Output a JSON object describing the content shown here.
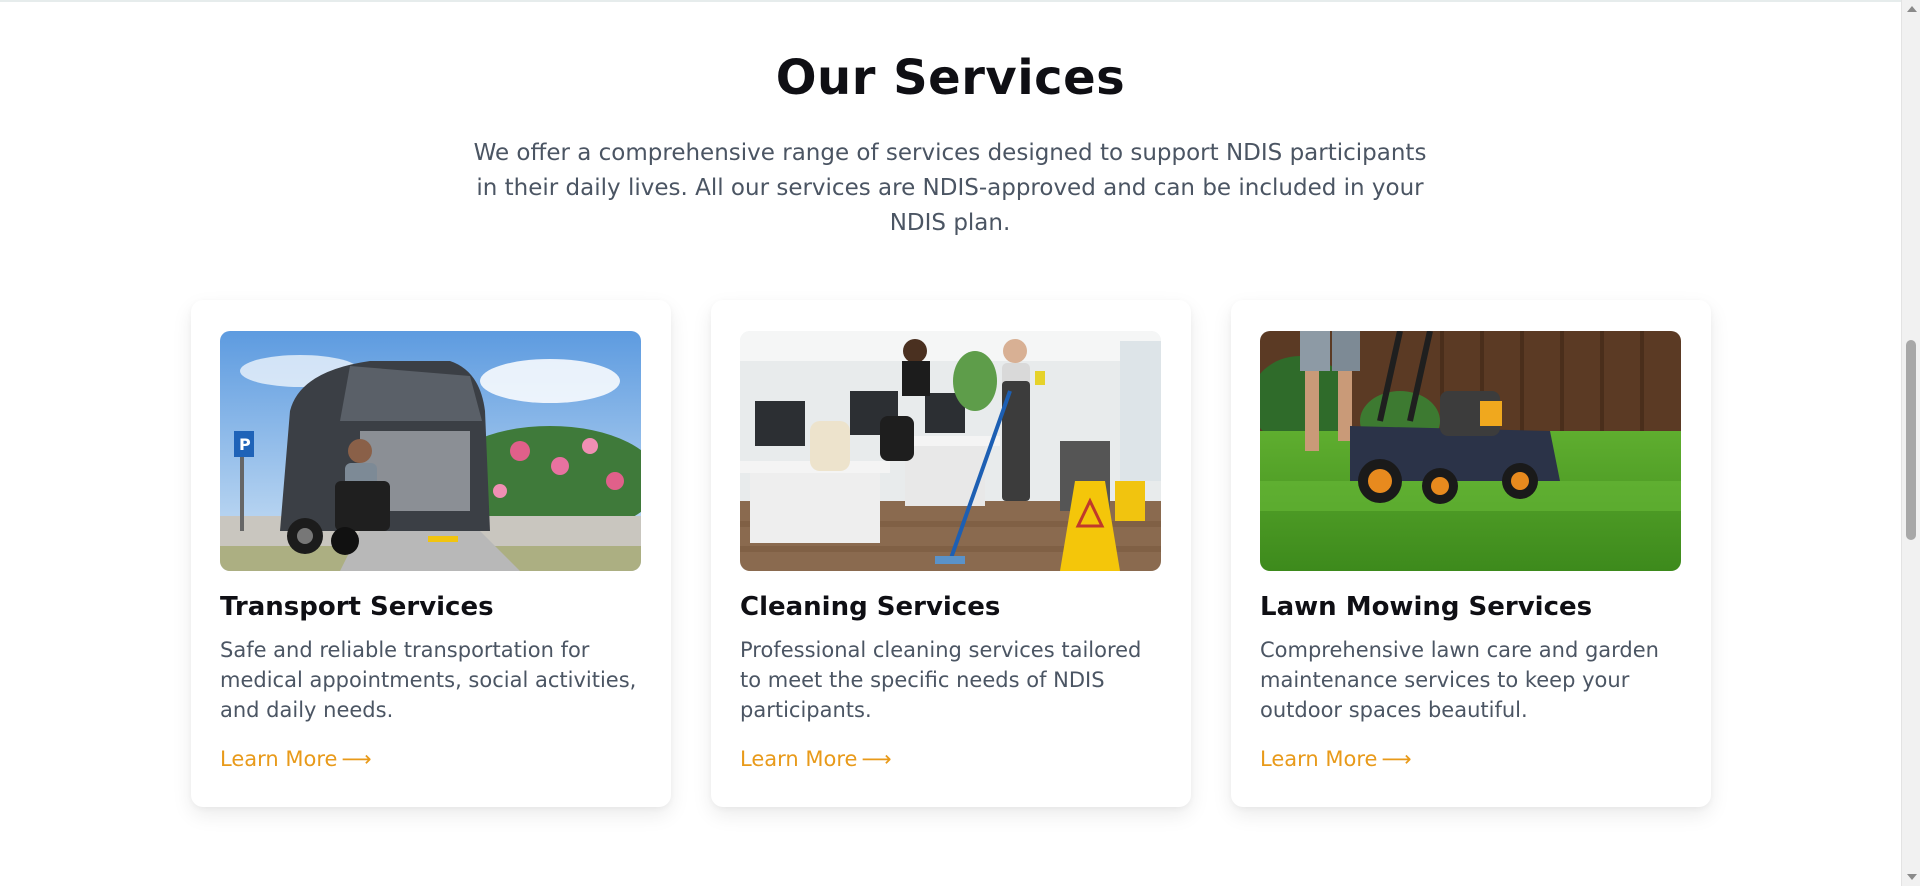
{
  "services": {
    "title": "Our Services",
    "subtitle": "We offer a comprehensive range of services designed to support NDIS participants in their daily lives. All our services are NDIS-approved and can be included in your NDIS plan.",
    "cards": [
      {
        "title": "Transport Services",
        "description": "Safe and reliable transportation for medical appointments, social activities, and daily needs.",
        "link_label": "Learn More",
        "link_arrow": "⟶",
        "image": "wheelchair-van-photo"
      },
      {
        "title": "Cleaning Services",
        "description": "Professional cleaning services tailored to meet the specific needs of NDIS participants.",
        "link_label": "Learn More",
        "link_arrow": "⟶",
        "image": "office-cleaning-photo"
      },
      {
        "title": "Lawn Mowing Services",
        "description": "Comprehensive lawn care and garden maintenance services to keep your outdoor spaces beautiful.",
        "link_label": "Learn More",
        "link_arrow": "⟶",
        "image": "lawn-mower-photo"
      }
    ]
  },
  "colors": {
    "accent": "#e89a1a",
    "heading": "#0f0f14",
    "body_text": "#4b5563"
  }
}
